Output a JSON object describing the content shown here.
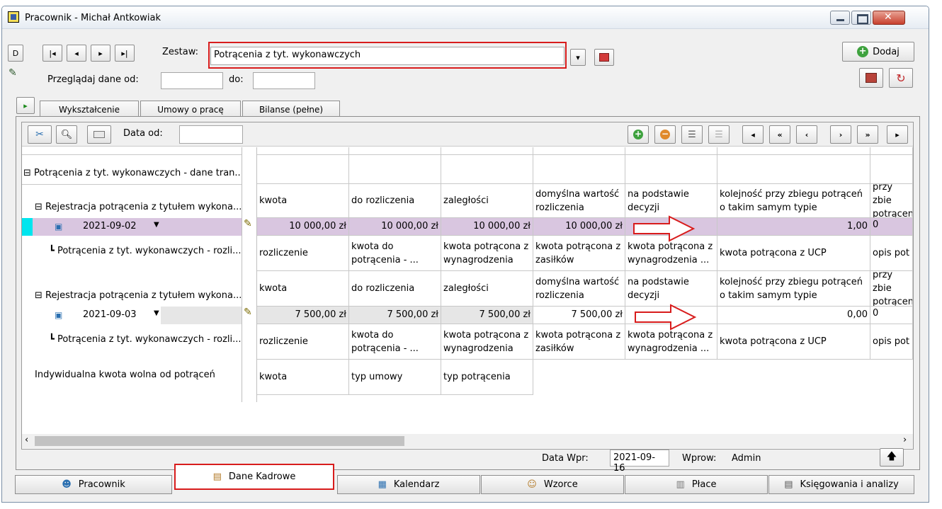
{
  "window": {
    "title": "Pracownik - Michał Antkowiak"
  },
  "toolbar": {
    "zestaw_label": "Zestaw:",
    "zestaw_value": "Potrącenia z tyt. wykonawczych",
    "dodaj_label": "Dodaj",
    "przegladaj_label": "Przeglądaj dane od:",
    "do_label": "do:",
    "przegladaj_od_value": "",
    "do_value": ""
  },
  "tabs": [
    "Wykształcenie",
    "Umowy o pracę",
    "Bilanse (pełne)"
  ],
  "inner_toolbar": {
    "data_od_label": "Data od:",
    "data_od_value": ""
  },
  "tree": {
    "root": "Potrącenia z tyt. wykonawczych - dane tran...",
    "reg1": "Rejestracja potrącenia z tytułem wykona...",
    "date1": "2021-09-02",
    "roz1": "Potrącenia z tyt. wykonawczych - rozli...",
    "reg2": "Rejestracja potrącenia z tytułem wykona...",
    "date2": "2021-09-03",
    "roz2": "Potrącenia z tyt. wykonawczych - rozli...",
    "indyw": "Indywidualna kwota wolna od potrąceń"
  },
  "headers_reg": [
    "kwota",
    "do rozliczenia",
    "zaległości",
    "domyślna wartość rozliczenia",
    "na podstawie decyzji",
    "kolejność przy zbiegu potrąceń o takim samym typie",
    "przy zbie potrącen"
  ],
  "row1_values": [
    "10 000,00 zł",
    "10 000,00 zł",
    "10 000,00 zł",
    "10 000,00 zł",
    "",
    "1,00",
    "0"
  ],
  "headers_roz": [
    "rozliczenie",
    "kwota do potrącenia - ...",
    "kwota potrącona z wynagrodzenia",
    "kwota potrącona z zasiłków",
    "kwota potrącona z wynagrodzenia ...",
    "kwota potrącona z UCP",
    "opis pot"
  ],
  "row2_values": [
    "7 500,00 zł",
    "7 500,00 zł",
    "7 500,00 zł",
    "7 500,00 zł",
    "",
    "0,00",
    "0"
  ],
  "headers_indyw": [
    "kwota",
    "typ umowy",
    "typ potrącenia"
  ],
  "status": {
    "data_wpr_label": "Data Wpr:",
    "data_wpr_value": "2021-09-16",
    "wprow_label": "Wprow:",
    "wprow_value": "Admin"
  },
  "bottom_tabs": [
    "Pracownik",
    "Dane Kadrowe",
    "Kalendarz",
    "Wzorce",
    "Płace",
    "Księgowania i analizy"
  ],
  "colors": {
    "highlight_row": "#d9c6e0",
    "selected_cell": "#00e5ee",
    "red_frame": "#d81c1c"
  }
}
